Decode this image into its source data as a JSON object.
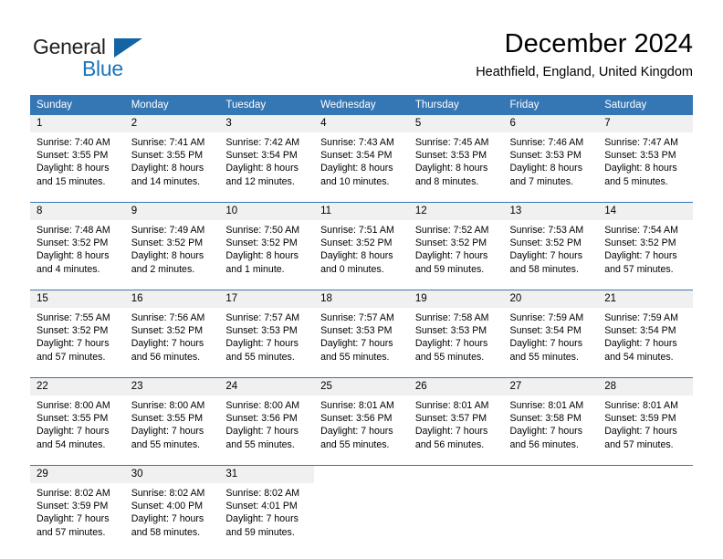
{
  "logo": {
    "word1": "General",
    "word2": "Blue",
    "triangle_color": "#1464a5",
    "word2_color": "#1b75bb"
  },
  "header": {
    "title": "December 2024",
    "subtitle": "Heathfield, England, United Kingdom"
  },
  "calendar": {
    "header_bg": "#3576b5",
    "daynum_bg": "#f0f0f0",
    "weekdays": [
      "Sunday",
      "Monday",
      "Tuesday",
      "Wednesday",
      "Thursday",
      "Friday",
      "Saturday"
    ],
    "weeks": [
      [
        {
          "day": "1",
          "sunrise": "Sunrise: 7:40 AM",
          "sunset": "Sunset: 3:55 PM",
          "daylight1": "Daylight: 8 hours",
          "daylight2": "and 15 minutes."
        },
        {
          "day": "2",
          "sunrise": "Sunrise: 7:41 AM",
          "sunset": "Sunset: 3:55 PM",
          "daylight1": "Daylight: 8 hours",
          "daylight2": "and 14 minutes."
        },
        {
          "day": "3",
          "sunrise": "Sunrise: 7:42 AM",
          "sunset": "Sunset: 3:54 PM",
          "daylight1": "Daylight: 8 hours",
          "daylight2": "and 12 minutes."
        },
        {
          "day": "4",
          "sunrise": "Sunrise: 7:43 AM",
          "sunset": "Sunset: 3:54 PM",
          "daylight1": "Daylight: 8 hours",
          "daylight2": "and 10 minutes."
        },
        {
          "day": "5",
          "sunrise": "Sunrise: 7:45 AM",
          "sunset": "Sunset: 3:53 PM",
          "daylight1": "Daylight: 8 hours",
          "daylight2": "and 8 minutes."
        },
        {
          "day": "6",
          "sunrise": "Sunrise: 7:46 AM",
          "sunset": "Sunset: 3:53 PM",
          "daylight1": "Daylight: 8 hours",
          "daylight2": "and 7 minutes."
        },
        {
          "day": "7",
          "sunrise": "Sunrise: 7:47 AM",
          "sunset": "Sunset: 3:53 PM",
          "daylight1": "Daylight: 8 hours",
          "daylight2": "and 5 minutes."
        }
      ],
      [
        {
          "day": "8",
          "sunrise": "Sunrise: 7:48 AM",
          "sunset": "Sunset: 3:52 PM",
          "daylight1": "Daylight: 8 hours",
          "daylight2": "and 4 minutes."
        },
        {
          "day": "9",
          "sunrise": "Sunrise: 7:49 AM",
          "sunset": "Sunset: 3:52 PM",
          "daylight1": "Daylight: 8 hours",
          "daylight2": "and 2 minutes."
        },
        {
          "day": "10",
          "sunrise": "Sunrise: 7:50 AM",
          "sunset": "Sunset: 3:52 PM",
          "daylight1": "Daylight: 8 hours",
          "daylight2": "and 1 minute."
        },
        {
          "day": "11",
          "sunrise": "Sunrise: 7:51 AM",
          "sunset": "Sunset: 3:52 PM",
          "daylight1": "Daylight: 8 hours",
          "daylight2": "and 0 minutes."
        },
        {
          "day": "12",
          "sunrise": "Sunrise: 7:52 AM",
          "sunset": "Sunset: 3:52 PM",
          "daylight1": "Daylight: 7 hours",
          "daylight2": "and 59 minutes."
        },
        {
          "day": "13",
          "sunrise": "Sunrise: 7:53 AM",
          "sunset": "Sunset: 3:52 PM",
          "daylight1": "Daylight: 7 hours",
          "daylight2": "and 58 minutes."
        },
        {
          "day": "14",
          "sunrise": "Sunrise: 7:54 AM",
          "sunset": "Sunset: 3:52 PM",
          "daylight1": "Daylight: 7 hours",
          "daylight2": "and 57 minutes."
        }
      ],
      [
        {
          "day": "15",
          "sunrise": "Sunrise: 7:55 AM",
          "sunset": "Sunset: 3:52 PM",
          "daylight1": "Daylight: 7 hours",
          "daylight2": "and 57 minutes."
        },
        {
          "day": "16",
          "sunrise": "Sunrise: 7:56 AM",
          "sunset": "Sunset: 3:52 PM",
          "daylight1": "Daylight: 7 hours",
          "daylight2": "and 56 minutes."
        },
        {
          "day": "17",
          "sunrise": "Sunrise: 7:57 AM",
          "sunset": "Sunset: 3:53 PM",
          "daylight1": "Daylight: 7 hours",
          "daylight2": "and 55 minutes."
        },
        {
          "day": "18",
          "sunrise": "Sunrise: 7:57 AM",
          "sunset": "Sunset: 3:53 PM",
          "daylight1": "Daylight: 7 hours",
          "daylight2": "and 55 minutes."
        },
        {
          "day": "19",
          "sunrise": "Sunrise: 7:58 AM",
          "sunset": "Sunset: 3:53 PM",
          "daylight1": "Daylight: 7 hours",
          "daylight2": "and 55 minutes."
        },
        {
          "day": "20",
          "sunrise": "Sunrise: 7:59 AM",
          "sunset": "Sunset: 3:54 PM",
          "daylight1": "Daylight: 7 hours",
          "daylight2": "and 55 minutes."
        },
        {
          "day": "21",
          "sunrise": "Sunrise: 7:59 AM",
          "sunset": "Sunset: 3:54 PM",
          "daylight1": "Daylight: 7 hours",
          "daylight2": "and 54 minutes."
        }
      ],
      [
        {
          "day": "22",
          "sunrise": "Sunrise: 8:00 AM",
          "sunset": "Sunset: 3:55 PM",
          "daylight1": "Daylight: 7 hours",
          "daylight2": "and 54 minutes."
        },
        {
          "day": "23",
          "sunrise": "Sunrise: 8:00 AM",
          "sunset": "Sunset: 3:55 PM",
          "daylight1": "Daylight: 7 hours",
          "daylight2": "and 55 minutes."
        },
        {
          "day": "24",
          "sunrise": "Sunrise: 8:00 AM",
          "sunset": "Sunset: 3:56 PM",
          "daylight1": "Daylight: 7 hours",
          "daylight2": "and 55 minutes."
        },
        {
          "day": "25",
          "sunrise": "Sunrise: 8:01 AM",
          "sunset": "Sunset: 3:56 PM",
          "daylight1": "Daylight: 7 hours",
          "daylight2": "and 55 minutes."
        },
        {
          "day": "26",
          "sunrise": "Sunrise: 8:01 AM",
          "sunset": "Sunset: 3:57 PM",
          "daylight1": "Daylight: 7 hours",
          "daylight2": "and 56 minutes."
        },
        {
          "day": "27",
          "sunrise": "Sunrise: 8:01 AM",
          "sunset": "Sunset: 3:58 PM",
          "daylight1": "Daylight: 7 hours",
          "daylight2": "and 56 minutes."
        },
        {
          "day": "28",
          "sunrise": "Sunrise: 8:01 AM",
          "sunset": "Sunset: 3:59 PM",
          "daylight1": "Daylight: 7 hours",
          "daylight2": "and 57 minutes."
        }
      ],
      [
        {
          "day": "29",
          "sunrise": "Sunrise: 8:02 AM",
          "sunset": "Sunset: 3:59 PM",
          "daylight1": "Daylight: 7 hours",
          "daylight2": "and 57 minutes."
        },
        {
          "day": "30",
          "sunrise": "Sunrise: 8:02 AM",
          "sunset": "Sunset: 4:00 PM",
          "daylight1": "Daylight: 7 hours",
          "daylight2": "and 58 minutes."
        },
        {
          "day": "31",
          "sunrise": "Sunrise: 8:02 AM",
          "sunset": "Sunset: 4:01 PM",
          "daylight1": "Daylight: 7 hours",
          "daylight2": "and 59 minutes."
        },
        {
          "day": "",
          "sunrise": "",
          "sunset": "",
          "daylight1": "",
          "daylight2": ""
        },
        {
          "day": "",
          "sunrise": "",
          "sunset": "",
          "daylight1": "",
          "daylight2": ""
        },
        {
          "day": "",
          "sunrise": "",
          "sunset": "",
          "daylight1": "",
          "daylight2": ""
        },
        {
          "day": "",
          "sunrise": "",
          "sunset": "",
          "daylight1": "",
          "daylight2": ""
        }
      ]
    ]
  }
}
